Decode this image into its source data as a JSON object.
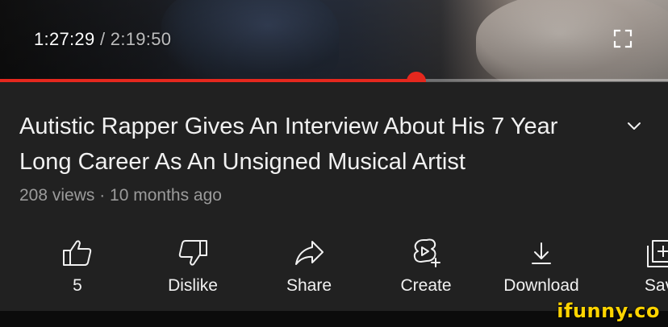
{
  "player": {
    "current_time": "1:27:29",
    "separator": "/",
    "duration": "2:19:50",
    "progress_fraction": 0.623,
    "fullscreen_icon": "fullscreen-icon",
    "colors": {
      "progress": "#e5281e",
      "track": "#8a8a8a"
    }
  },
  "video": {
    "title": "Autistic Rapper Gives An Interview About His 7 Year Long Career As An Unsigned Musical Artist",
    "meta": "208 views · 10 months ago",
    "expand_icon": "chevron-down-icon"
  },
  "actions": [
    {
      "label": "5",
      "icon": "thumbs-up-icon"
    },
    {
      "label": "Dislike",
      "icon": "thumbs-down-icon"
    },
    {
      "label": "Share",
      "icon": "share-arrow-icon"
    },
    {
      "label": "Create",
      "icon": "create-shorts-icon"
    },
    {
      "label": "Download",
      "icon": "download-icon"
    },
    {
      "label": "Sav",
      "icon": "save-playlist-icon"
    }
  ],
  "watermark": "ifunny.co"
}
